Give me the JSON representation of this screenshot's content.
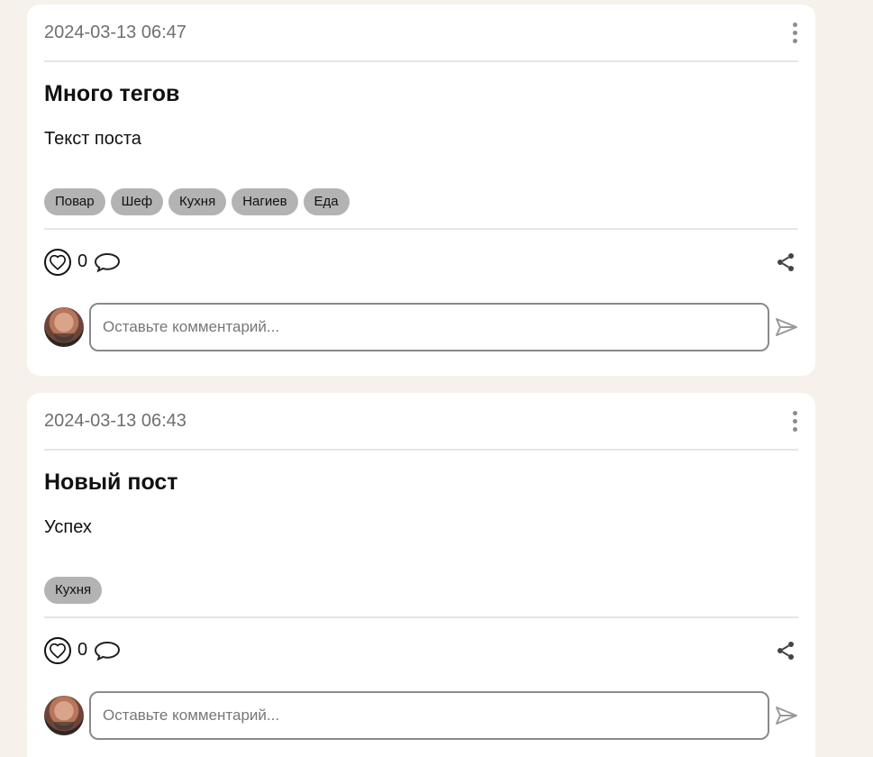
{
  "posts": [
    {
      "date": "2024-03-13 06:47",
      "title": "Много тегов",
      "text": "Текст поста",
      "tags": [
        "Повар",
        "Шеф",
        "Кухня",
        "Нагиев",
        "Еда"
      ],
      "likes": "0",
      "comment_placeholder": "Оставьте комментарий..."
    },
    {
      "date": "2024-03-13 06:43",
      "title": "Новый пост",
      "text": "Успех",
      "tags": [
        "Кухня"
      ],
      "likes": "0",
      "comment_placeholder": "Оставьте комментарий..."
    }
  ],
  "icons": {
    "menu": "more-vertical-icon",
    "like": "heart-icon",
    "comment": "comment-icon",
    "share": "share-icon",
    "send": "send-icon"
  },
  "colors": {
    "background": "#f6f1ea",
    "card": "#ffffff",
    "tag": "#b3b3b3",
    "date": "#6f6f6f"
  }
}
